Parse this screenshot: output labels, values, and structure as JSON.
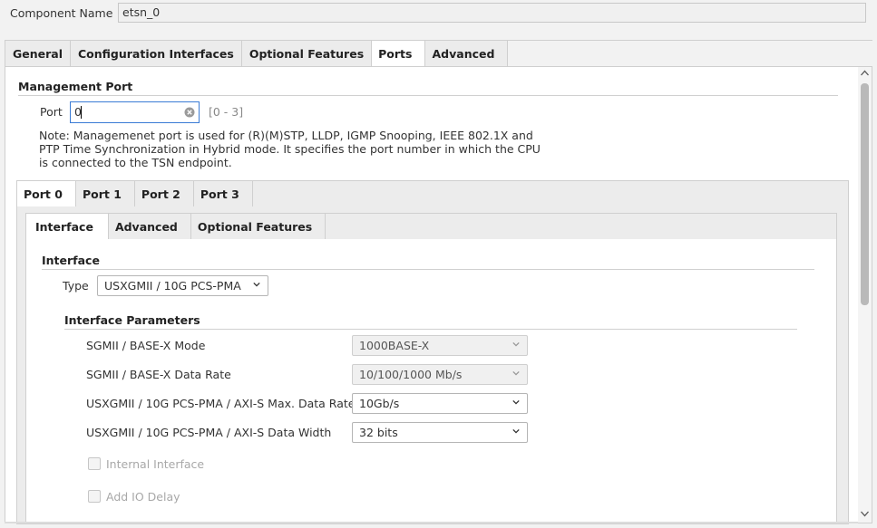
{
  "component": {
    "label": "Component Name",
    "value": "etsn_0"
  },
  "main_tabs": [
    "General",
    "Configuration Interfaces",
    "Optional Features",
    "Ports",
    "Advanced"
  ],
  "management": {
    "title": "Management Port",
    "port_label": "Port",
    "port_value": "0",
    "port_range": "[0 - 3]",
    "note_lines": [
      "Note: Managemenet port is used for (R)(M)STP, LLDP, IGMP Snooping, IEEE 802.1X and",
      "PTP Time Synchronization in Hybrid mode. It specifies the port number in which the CPU",
      "is connected to the TSN endpoint."
    ]
  },
  "port_tabs": [
    "Port 0",
    "Port 1",
    "Port 2",
    "Port 3"
  ],
  "sub_tabs": [
    "Interface",
    "Advanced",
    "Optional Features"
  ],
  "interface": {
    "title": "Interface",
    "type_label": "Type",
    "type_value": "USXGMII / 10G PCS-PMA"
  },
  "params": {
    "title": "Interface Parameters",
    "rows": [
      {
        "label": "SGMII / BASE-X Mode",
        "value": "1000BASE-X"
      },
      {
        "label": "SGMII / BASE-X Data Rate",
        "value": "10/100/1000 Mb/s"
      },
      {
        "label": "USXGMII / 10G PCS-PMA / AXI-S Max. Data Rate",
        "value": "10Gb/s"
      },
      {
        "label": "USXGMII / 10G PCS-PMA / AXI-S Data Width",
        "value": "32 bits"
      }
    ]
  },
  "checkboxes": [
    {
      "label": "Internal Interface"
    },
    {
      "label": "Add IO Delay"
    }
  ]
}
